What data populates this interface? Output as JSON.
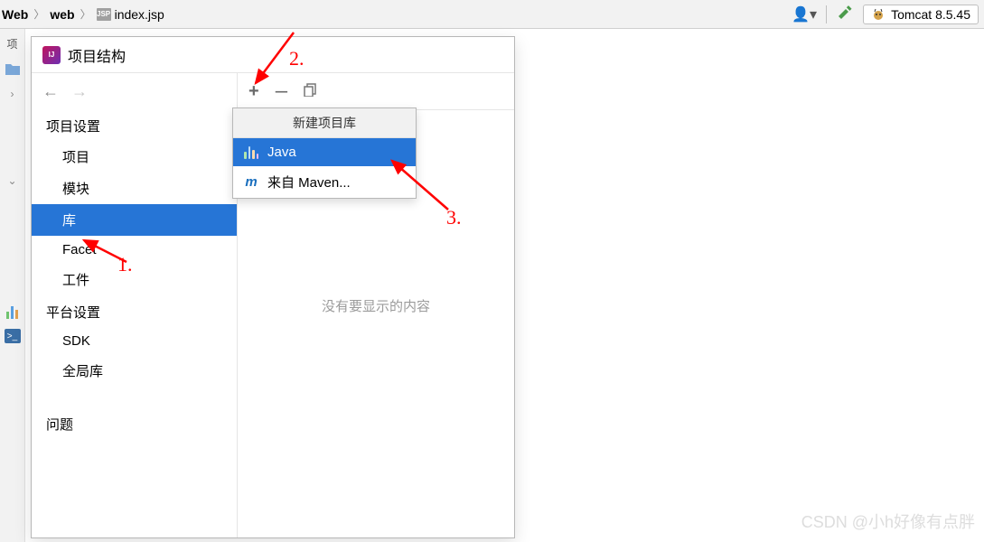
{
  "breadcrumb": {
    "item1": "Web",
    "item2": "web",
    "item3": "index.jsp",
    "jspBadge": "JSP"
  },
  "tomcat": {
    "label": "Tomcat 8.5.45"
  },
  "leftStrip": {
    "proj": "项"
  },
  "dialog": {
    "title": "项目结构"
  },
  "sidebar": {
    "section1": "项目设置",
    "items1": [
      "项目",
      "模块",
      "库",
      "Facet",
      "工件"
    ],
    "section2": "平台设置",
    "items2": [
      "SDK",
      "全局库"
    ],
    "problems": "问题"
  },
  "toolbar": {
    "plus": "+",
    "minus": "–",
    "copy": "⧉"
  },
  "popup": {
    "header": "新建项目库",
    "java": "Java",
    "maven": "来自 Maven..."
  },
  "main": {
    "empty": "没有要显示的内容"
  },
  "annotations": {
    "a1": "1.",
    "a2": "2.",
    "a3": "3."
  },
  "watermark": "CSDN @小h好像有点胖"
}
